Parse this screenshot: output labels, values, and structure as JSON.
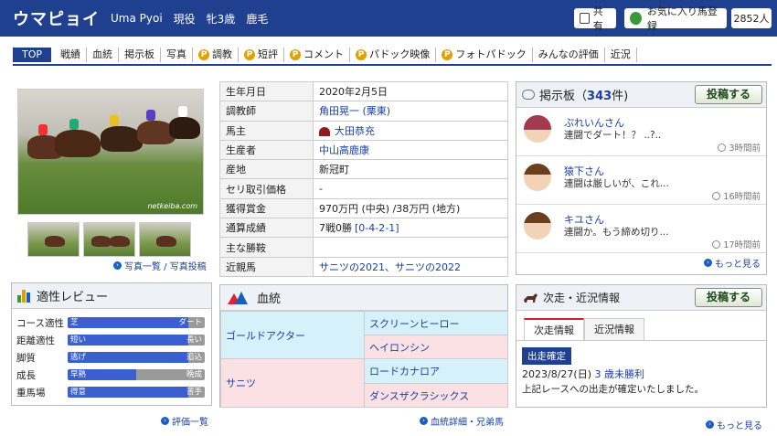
{
  "header": {
    "horse_name": "ウマピョイ",
    "romaji": "Uma Pyoi",
    "status": "現役",
    "sex_age": "牝3歳",
    "coat": "鹿毛",
    "share_label": "共有",
    "favorite_label": "お気に入り馬登録",
    "favorite_count": "2852人"
  },
  "tabs": [
    {
      "label": "TOP",
      "active": true,
      "premium": false
    },
    {
      "label": "戦績",
      "premium": false
    },
    {
      "label": "血統",
      "premium": false
    },
    {
      "label": "掲示板",
      "premium": false
    },
    {
      "label": "写真",
      "premium": false
    },
    {
      "label": "調教",
      "premium": true
    },
    {
      "label": "短評",
      "premium": true
    },
    {
      "label": "コメント",
      "premium": true
    },
    {
      "label": "パドック映像",
      "premium": true
    },
    {
      "label": "フォトパドック",
      "premium": true
    },
    {
      "label": "みんなの評価",
      "premium": false
    },
    {
      "label": "近況",
      "premium": false
    }
  ],
  "premium_badge": "P",
  "photos": {
    "watermark": "netkeiba.com",
    "link_label": "写真一覧 / 写真投稿"
  },
  "profile": [
    {
      "label": "生年月日",
      "value": "2020年2月5日"
    },
    {
      "label": "調教師",
      "value": "角田晃一 (栗東)",
      "link": true
    },
    {
      "label": "馬主",
      "value": "大田恭充",
      "link": true
    },
    {
      "label": "生産者",
      "value": "中山高鹿康",
      "link": true
    },
    {
      "label": "産地",
      "value": "新冠町"
    },
    {
      "label": "セリ取引価格",
      "value": "-"
    },
    {
      "label": "獲得賞金",
      "value": "970万円 (中央) /38万円 (地方)"
    },
    {
      "label": "通算成績",
      "value": "7戦0勝",
      "value_link": "[0-4-2-1]"
    },
    {
      "label": "主な勝鞍",
      "value": ""
    },
    {
      "label": "近親馬",
      "value": "サニツの2021、サニツの2022",
      "link": true
    }
  ],
  "board": {
    "title": "掲示板",
    "count": "343",
    "count_suffix": "件)",
    "post_label": "投稿する",
    "comments": [
      {
        "user": "ぷれいんさん",
        "text": "連闘でダート！？ ..?..",
        "time": "3時間前",
        "avatar": "female"
      },
      {
        "user": "猿下さん",
        "text": "連闘は厳しいが、これ...",
        "time": "16時間前",
        "avatar": "male"
      },
      {
        "user": "キユさん",
        "text": "連闘か。もう締め切り...",
        "time": "17時間前",
        "avatar": "male"
      }
    ],
    "more_label": "もっと見る"
  },
  "review": {
    "title": "適性レビュー",
    "rows": [
      {
        "label": "コース適性",
        "left": "芝",
        "right": "ダート",
        "value": 0.88
      },
      {
        "label": "距離適性",
        "left": "短い",
        "right": "長い",
        "value": 0.88
      },
      {
        "label": "脚質",
        "left": "逃げ",
        "right": "追込",
        "value": 0.88
      },
      {
        "label": "成長",
        "left": "早熟",
        "right": "晩成",
        "value": 0.5
      },
      {
        "label": "重馬場",
        "left": "得意",
        "right": "苦手",
        "value": 0.88
      }
    ],
    "link_label": "評価一覧"
  },
  "pedigree": {
    "title": "血統",
    "sire": "ゴールドアクター",
    "sire_sire": "スクリーンヒーロー",
    "sire_dam": "ヘイロンシン",
    "dam": "サニツ",
    "dam_sire": "ロードカナロア",
    "dam_dam": "ダンスザクラシックス",
    "link_label": "血統詳細・兄弟馬"
  },
  "race": {
    "title": "次走・近況情報",
    "post_label": "投稿する",
    "tab1": "次走情報",
    "tab2": "近況情報",
    "badge": "出走確定",
    "date": "2023/8/27(日)",
    "race_name": "3 歳未勝利",
    "note": "上記レースへの出走が確定いたしました。",
    "more_label": "もっと見る"
  },
  "colors": {
    "header_bg": "#1f3f8f",
    "link": "#1a3fa0",
    "premium": "#e0a000",
    "sire_bg": "#d6f1f9",
    "dam_bg": "#fbe0e4",
    "bar_fill": "#3b5fd0"
  }
}
